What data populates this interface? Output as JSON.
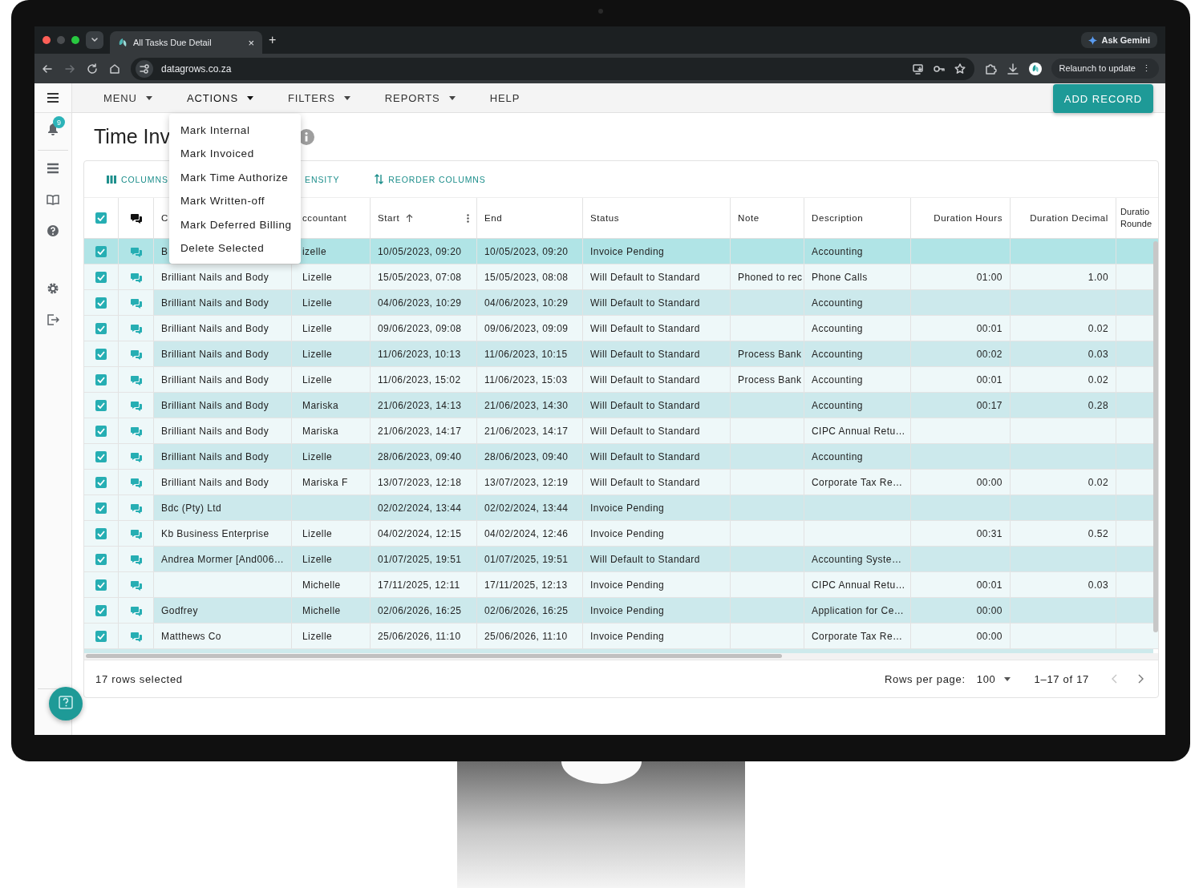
{
  "browser": {
    "tab_title": "All Tasks Due Detail",
    "tab_close": "×",
    "new_tab": "+",
    "url": "datagrows.co.za",
    "gemini_button": "Ask Gemini",
    "relaunch_button": "Relaunch to update",
    "relaunch_menu": "⋮"
  },
  "sidebar": {
    "notification_badge": "9"
  },
  "menu_bar": [
    {
      "label": "MENU",
      "has_dropdown": true,
      "expanded": false
    },
    {
      "label": "ACTIONS",
      "has_dropdown": true,
      "expanded": true
    },
    {
      "label": "FILTERS",
      "has_dropdown": true,
      "expanded": false
    },
    {
      "label": "REPORTS",
      "has_dropdown": true,
      "expanded": false
    },
    {
      "label": "HELP",
      "has_dropdown": false,
      "expanded": false
    }
  ],
  "add_button": "ADD RECORD",
  "actions_menu": [
    "Mark Internal",
    "Mark Invoiced",
    "Mark Time Authorize",
    "Mark Written-off",
    "Mark Deferred Billing",
    "Delete Selected"
  ],
  "page_title": "Time Inv",
  "grid_toolbar": [
    {
      "label": "COLUMNS",
      "kind": "columns"
    },
    {
      "label": "ENSITY",
      "kind": "density"
    },
    {
      "label": "REORDER COLUMNS",
      "kind": "reorder"
    }
  ],
  "table": {
    "all_checked": true,
    "columns": [
      {
        "label": "C",
        "kind": "text"
      },
      {
        "label": "ccountant",
        "kind": "text"
      },
      {
        "label": "Start",
        "kind": "text",
        "sorted": true
      },
      {
        "label": "End",
        "kind": "text"
      },
      {
        "label": "Status",
        "kind": "text"
      },
      {
        "label": "Note",
        "kind": "text"
      },
      {
        "label": "Description",
        "kind": "text"
      },
      {
        "label": "Duration Hours",
        "kind": "number"
      },
      {
        "label": "Duration Decimal",
        "kind": "number"
      },
      {
        "label": "Duratio Rounde",
        "kind": "text"
      }
    ],
    "rows": [
      {
        "checked": true,
        "hovered": true,
        "cells": {
          "client": "B",
          "accountant": "izelle",
          "start": "10/05/2023, 09:20",
          "end": "10/05/2023, 09:20",
          "status": "Invoice Pending",
          "description": "Accounting"
        }
      },
      {
        "checked": true,
        "hovered": false,
        "cells": {
          "client": "Brilliant Nails and Body",
          "accountant": "Lizelle",
          "start": "15/05/2023, 07:08",
          "end": "15/05/2023, 08:08",
          "status": "Will Default to Standard",
          "note": "Phoned to rec",
          "description": "Phone Calls",
          "hours": "01:00",
          "decimal": "1.00"
        }
      },
      {
        "checked": true,
        "hovered": false,
        "cells": {
          "client": "Brilliant Nails and Body",
          "accountant": "Lizelle",
          "start": "04/06/2023, 10:29",
          "end": "04/06/2023, 10:29",
          "status": "Will Default to Standard",
          "description": "Accounting"
        }
      },
      {
        "checked": true,
        "hovered": false,
        "cells": {
          "client": "Brilliant Nails and Body",
          "accountant": "Lizelle",
          "start": "09/06/2023, 09:08",
          "end": "09/06/2023, 09:09",
          "status": "Will Default to Standard",
          "description": "Accounting",
          "hours": "00:01",
          "decimal": "0.02"
        }
      },
      {
        "checked": true,
        "hovered": false,
        "cells": {
          "client": "Brilliant Nails and Body",
          "accountant": "Lizelle",
          "start": "11/06/2023, 10:13",
          "end": "11/06/2023, 10:15",
          "status": "Will Default to Standard",
          "note": "Process Bank",
          "description": "Accounting",
          "hours": "00:02",
          "decimal": "0.03"
        }
      },
      {
        "checked": true,
        "hovered": false,
        "cells": {
          "client": "Brilliant Nails and Body",
          "accountant": "Lizelle",
          "start": "11/06/2023, 15:02",
          "end": "11/06/2023, 15:03",
          "status": "Will Default to Standard",
          "note": "Process Bank",
          "description": "Accounting",
          "hours": "00:01",
          "decimal": "0.02"
        }
      },
      {
        "checked": true,
        "hovered": false,
        "cells": {
          "client": "Brilliant Nails and Body",
          "accountant": "Mariska",
          "start": "21/06/2023, 14:13",
          "end": "21/06/2023, 14:30",
          "status": "Will Default to Standard",
          "description": "Accounting",
          "hours": "00:17",
          "decimal": "0.28"
        }
      },
      {
        "checked": true,
        "hovered": false,
        "cells": {
          "client": "Brilliant Nails and Body",
          "accountant": "Mariska",
          "start": "21/06/2023, 14:17",
          "end": "21/06/2023, 14:17",
          "status": "Will Default to Standard",
          "description": "CIPC Annual Retu…"
        }
      },
      {
        "checked": true,
        "hovered": false,
        "cells": {
          "client": "Brilliant Nails and Body",
          "accountant": "Lizelle",
          "start": "28/06/2023, 09:40",
          "end": "28/06/2023, 09:40",
          "status": "Will Default to Standard",
          "description": "Accounting"
        }
      },
      {
        "checked": true,
        "hovered": false,
        "cells": {
          "client": "Brilliant Nails and Body",
          "accountant": "Mariska F",
          "start": "13/07/2023, 12:18",
          "end": "13/07/2023, 12:19",
          "status": "Will Default to Standard",
          "description": "Corporate Tax Re…",
          "hours": "00:00",
          "decimal": "0.02"
        }
      },
      {
        "checked": true,
        "hovered": false,
        "cells": {
          "client": "Bdc (Pty) Ltd",
          "start": "02/02/2024, 13:44",
          "end": "02/02/2024, 13:44",
          "status": "Invoice Pending"
        }
      },
      {
        "checked": true,
        "hovered": false,
        "cells": {
          "client": "Kb Business Enterprise",
          "accountant": "Lizelle",
          "start": "04/02/2024, 12:15",
          "end": "04/02/2024, 12:46",
          "status": "Invoice Pending",
          "hours": "00:31",
          "decimal": "0.52"
        }
      },
      {
        "checked": true,
        "hovered": false,
        "cells": {
          "client": "Andrea Mormer [And006…",
          "accountant": "Lizelle",
          "start": "01/07/2025, 19:51",
          "end": "01/07/2025, 19:51",
          "status": "Will Default to Standard",
          "description": "Accounting Syste…"
        }
      },
      {
        "checked": true,
        "hovered": false,
        "cells": {
          "accountant": "Michelle",
          "start": "17/11/2025, 12:11",
          "end": "17/11/2025, 12:13",
          "status": "Invoice Pending",
          "description": "CIPC Annual Retu…",
          "hours": "00:01",
          "decimal": "0.03"
        }
      },
      {
        "checked": true,
        "hovered": false,
        "cells": {
          "client": "Godfrey",
          "accountant": "Michelle",
          "start": "02/06/2026, 16:25",
          "end": "02/06/2026, 16:25",
          "status": "Invoice Pending",
          "description": "Application for Ce…",
          "hours": "00:00"
        }
      },
      {
        "checked": true,
        "hovered": false,
        "cells": {
          "client": "Matthews Co",
          "accountant": "Lizelle",
          "start": "25/06/2026, 11:10",
          "end": "25/06/2026, 11:10",
          "status": "Invoice Pending",
          "description": "Corporate Tax Re…",
          "hours": "00:00"
        }
      }
    ]
  },
  "footer": {
    "selection": "17 rows selected",
    "rows_per_page_label": "Rows per page:",
    "rows_per_page": "100",
    "range": "1–17 of 17",
    "prev_disabled": true,
    "next_disabled": false
  }
}
